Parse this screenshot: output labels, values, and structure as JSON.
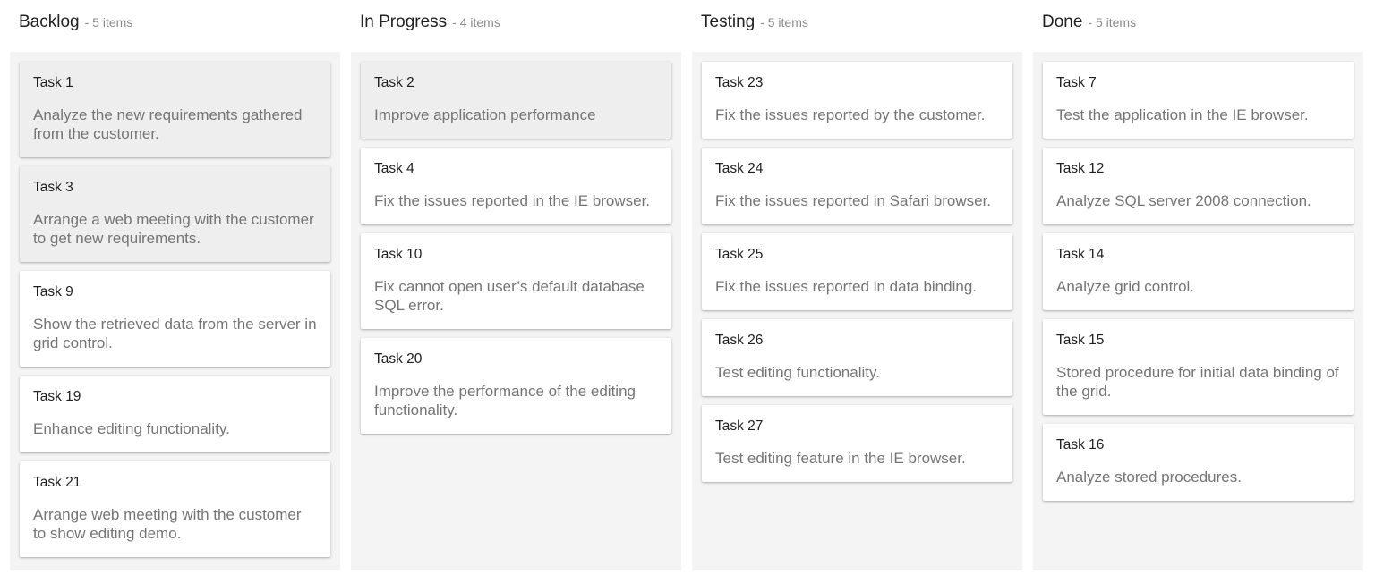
{
  "columns": [
    {
      "title": "Backlog",
      "count": "- 5 items",
      "cards": [
        {
          "title": "Task 1",
          "desc": "Analyze the new requirements gathered from the customer.",
          "selected": true
        },
        {
          "title": "Task 3",
          "desc": "Arrange a web meeting with the customer to get new requirements.",
          "selected": true
        },
        {
          "title": "Task 9",
          "desc": "Show the retrieved data from the server in grid control.",
          "selected": false
        },
        {
          "title": "Task 19",
          "desc": "Enhance editing functionality.",
          "selected": false
        },
        {
          "title": "Task 21",
          "desc": "Arrange web meeting with the customer to show editing demo.",
          "selected": false
        }
      ]
    },
    {
      "title": "In Progress",
      "count": "- 4 items",
      "cards": [
        {
          "title": "Task 2",
          "desc": "Improve application performance",
          "selected": true
        },
        {
          "title": "Task 4",
          "desc": "Fix the issues reported in the IE browser.",
          "selected": false
        },
        {
          "title": "Task 10",
          "desc": "Fix cannot open user’s default database SQL error.",
          "selected": false
        },
        {
          "title": "Task 20",
          "desc": "Improve the performance of the editing functionality.",
          "selected": false
        }
      ]
    },
    {
      "title": "Testing",
      "count": "- 5 items",
      "cards": [
        {
          "title": "Task 23",
          "desc": "Fix the issues reported by the customer.",
          "selected": false
        },
        {
          "title": "Task 24",
          "desc": "Fix the issues reported in Safari browser.",
          "selected": false
        },
        {
          "title": "Task 25",
          "desc": "Fix the issues reported in data binding.",
          "selected": false
        },
        {
          "title": "Task 26",
          "desc": "Test editing functionality.",
          "selected": false
        },
        {
          "title": "Task 27",
          "desc": "Test editing feature in the IE browser.",
          "selected": false
        }
      ]
    },
    {
      "title": "Done",
      "count": "- 5 items",
      "cards": [
        {
          "title": "Task 7",
          "desc": "Test the application in the IE browser.",
          "selected": false
        },
        {
          "title": "Task 12",
          "desc": "Analyze SQL server 2008 connection.",
          "selected": false
        },
        {
          "title": "Task 14",
          "desc": "Analyze grid control.",
          "selected": false
        },
        {
          "title": "Task 15",
          "desc": "Stored procedure for initial data binding of the grid.",
          "selected": false
        },
        {
          "title": "Task 16",
          "desc": "Analyze stored procedures.",
          "selected": false
        }
      ]
    }
  ]
}
